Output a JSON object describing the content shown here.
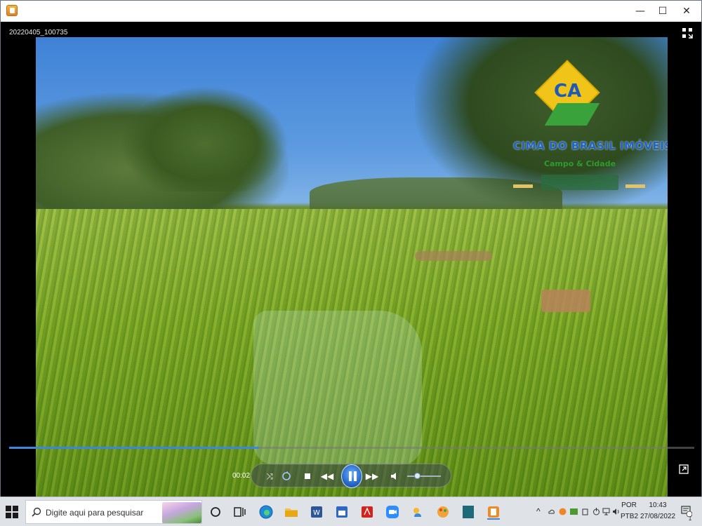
{
  "window": {
    "file_name": "20220405_100735",
    "controls": {
      "minimize": "—",
      "maximize": "☐",
      "close": "✕"
    }
  },
  "video": {
    "elapsed_time": "00:02",
    "progress_fraction": 0.365,
    "volume_fraction": 0.3,
    "watermark": {
      "brand_initials": "CA",
      "brand_name": "CIMA DO BRASIL IMÓVEIS",
      "tagline": "Campo & Cidade"
    }
  },
  "taskbar": {
    "search_placeholder": "Digite aqui para pesquisar",
    "pinned_apps": [
      "task-view",
      "edge",
      "file-explorer",
      "word",
      "calendar",
      "acrobat",
      "zoom",
      "weather",
      "paint",
      "notes",
      "media-player"
    ],
    "language": "POR",
    "keyboard": "PTB2",
    "time": "10:43",
    "date": "27/08/2022",
    "notification_count": "1"
  },
  "colors": {
    "accent": "#3d86e0",
    "titlebar": "#ffffff",
    "taskbar": "#dfe3e8"
  }
}
